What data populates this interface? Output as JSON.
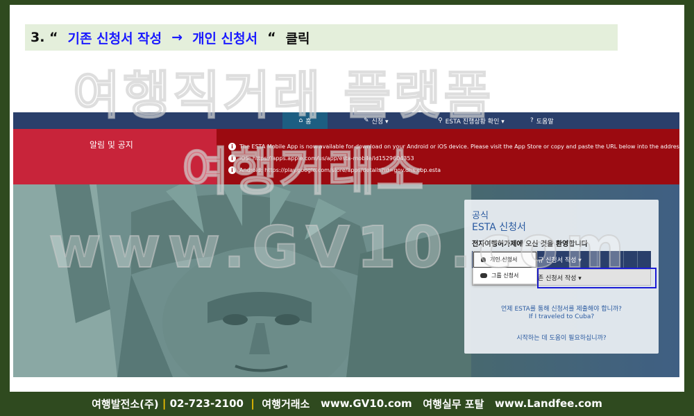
{
  "instruction": {
    "prefix": "3. “",
    "part1": "기존 신청서 작성",
    "arrow": "→",
    "part2": "개인 신청서",
    "suffix": "“",
    "action": "클릭"
  },
  "watermark": {
    "line1": "여행직거래 플랫폼",
    "line2": "여행거래소",
    "line3": "www.GV10.com"
  },
  "nav": {
    "home": "홈",
    "apply": "신청 ▾",
    "status": "ESTA 진행상황 확인 ▾",
    "help": "도움말"
  },
  "alert": {
    "title": "알림 및 공지",
    "lines": [
      "The ESTA Mobile App is now available for download on your Android or iOS device. Please visit the App Store or copy and paste the URL below into the address bar of your browser.",
      "iOS: https://apps.apple.com/us/app/esta-mobile/id1529604353",
      "Android: https://play.google.com/store/apps/details?id=gov.dhs.cbp.esta"
    ]
  },
  "panel": {
    "small": "공식",
    "title": "ESTA 신청서",
    "welcome": "전자여행허가제에 오신 것을 환영합니다",
    "new_app": "규 신청서 작성 ▾",
    "existing_app": "존 신청서 작성 ▾",
    "dropdown": [
      "개인 신청서",
      "그룹 신청서"
    ],
    "q1": "언제 ESTA를 통해 신청서를 제출해야 합니까?",
    "q2": "If I traveled to Cuba?",
    "q3": "시작하는 데 도움이 필요하십니까?"
  },
  "footer": {
    "company": "여행발전소(주)",
    "phone": "02-723-2100",
    "brand1": "여행거래소",
    "url1": "www.GV10.com",
    "brand2": "여행실무 포탈",
    "url2": "www.Landfee.com"
  },
  "colors": {
    "nav": "#2a3f6b",
    "alert": "#9b0a10",
    "alert_title": "#c8243a",
    "highlight": "#1b1bd6",
    "instruction_blue": "#1a1aff"
  }
}
